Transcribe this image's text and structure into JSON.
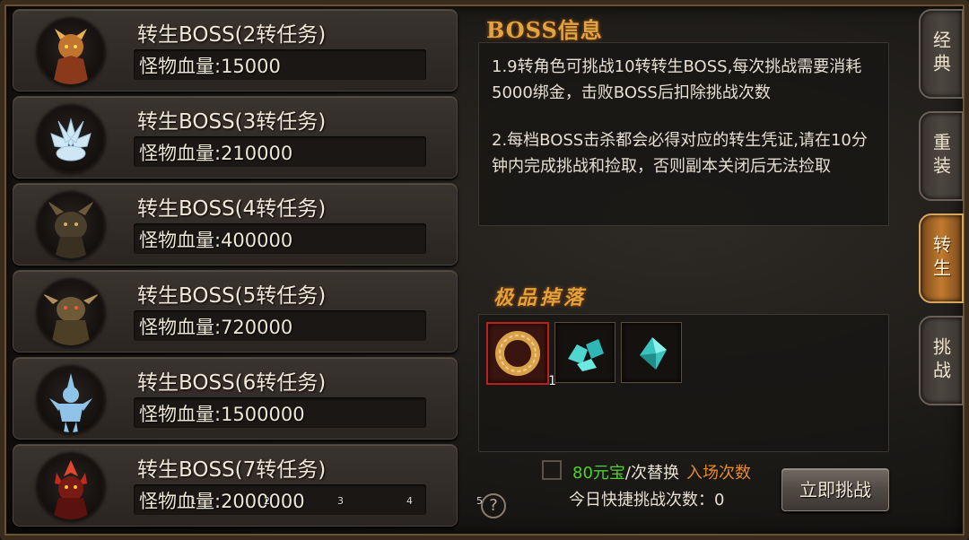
{
  "bosses": [
    {
      "name": "转生BOSS(2转任务)",
      "hp": "怪物血量:15000",
      "avatar": "demon-warrior-icon",
      "color": "#c2752e"
    },
    {
      "name": "转生BOSS(3转任务)",
      "hp": "怪物血量:210000",
      "avatar": "ice-lotus-icon",
      "color": "#cfe7f5"
    },
    {
      "name": "转生BOSS(4转任务)",
      "hp": "怪物血量:400000",
      "avatar": "horned-beast-icon",
      "color": "#7a6a4a"
    },
    {
      "name": "转生BOSS(5转任务)",
      "hp": "怪物血量:720000",
      "avatar": "bull-demon-icon",
      "color": "#8f6e3c"
    },
    {
      "name": "转生BOSS(6转任务)",
      "hp": "怪物血量:1500000",
      "avatar": "ice-knight-icon",
      "color": "#8fc4e8"
    },
    {
      "name": "转生BOSS(7转任务)",
      "hp": "怪物血量:2000000",
      "avatar": "flame-demon-icon",
      "color": "#c42a1e"
    }
  ],
  "info": {
    "title": "BOSS信息",
    "para1": "1.9转角色可挑战10转转生BOSS,每次挑战需要消耗5000绑金，击败BOSS后扣除挑战次数",
    "para2": "2.每档BOSS击杀都会必得对应的转生凭证,请在10分钟内完成挑战和捡取，否则副本关闭后无法捡取"
  },
  "drops": {
    "title": "极品掉落",
    "items": [
      {
        "icon": "gold-ring-icon",
        "count": "1"
      },
      {
        "icon": "cyan-crystal-icon",
        "count": ""
      },
      {
        "icon": "cyan-gem-icon",
        "count": ""
      }
    ]
  },
  "options": {
    "cost": "80元宝",
    "replace": "/次替换",
    "entry": "入场次数",
    "quick": "今日快捷挑战次数：0"
  },
  "challenge_button": "立即挑战",
  "help": "?",
  "tiny_numbers": [
    "1",
    "2",
    "3",
    "4",
    "5"
  ],
  "tabs": [
    {
      "label": "经典",
      "active": false
    },
    {
      "label": "重装",
      "active": false
    },
    {
      "label": "转生",
      "active": true
    },
    {
      "label": "挑战",
      "active": false
    }
  ],
  "colors": {
    "accent_gold": "#e1a443",
    "green": "#4fd12f",
    "orange": "#e58a2c",
    "selected_red": "#c01d1d"
  }
}
